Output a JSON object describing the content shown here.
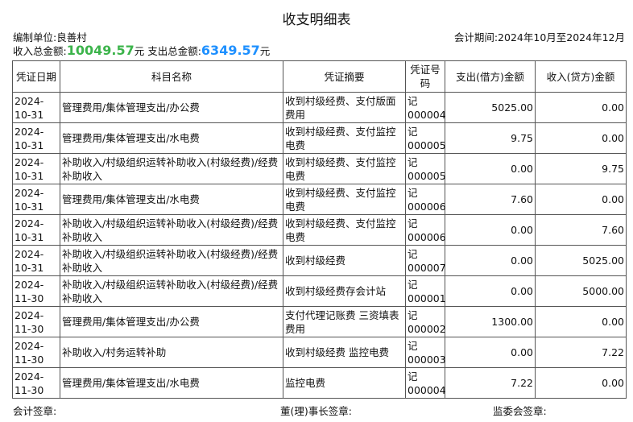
{
  "title": "收支明细表",
  "unit_label": "编制单位:良善村",
  "period_label": "会计期间:2024年10月至2024年12月",
  "totals": {
    "income_label": "收入总金额:",
    "income_value": "10049.57",
    "income_suffix": "元 支出总金额:",
    "expense_value": "6349.57",
    "expense_suffix": "元"
  },
  "table": {
    "headers": [
      "凭证日期",
      "科目名称",
      "凭证摘要",
      "凭证号码",
      "支出(借方)金额",
      "收入(贷方)金额"
    ],
    "rows": [
      {
        "date": "2024-10-31",
        "account": "管理费用/集体管理支出/办公费",
        "summary": "收到村级经费、支付版面费用",
        "voucher": "记000004",
        "debit": "5025.00",
        "credit": "0.00"
      },
      {
        "date": "2024-10-31",
        "account": "管理费用/集体管理支出/水电费",
        "summary": "收到村级经费、支付监控电费",
        "voucher": "记000005",
        "debit": "9.75",
        "credit": "0.00"
      },
      {
        "date": "2024-10-31",
        "account": "补助收入/村级组织运转补助收入(村级经费)/经费补助收入",
        "summary": "收到村级经费、支付监控电费",
        "voucher": "记000005",
        "debit": "0.00",
        "credit": "9.75"
      },
      {
        "date": "2024-10-31",
        "account": "管理费用/集体管理支出/水电费",
        "summary": "收到村级经费、支付监控电费",
        "voucher": "记000006",
        "debit": "7.60",
        "credit": "0.00"
      },
      {
        "date": "2024-10-31",
        "account": "补助收入/村级组织运转补助收入(村级经费)/经费补助收入",
        "summary": "收到村级经费、支付监控电费",
        "voucher": "记000006",
        "debit": "0.00",
        "credit": "7.60"
      },
      {
        "date": "2024-10-31",
        "account": "补助收入/村级组织运转补助收入(村级经费)/经费补助收入",
        "summary": "收到村级经费",
        "voucher": "记000007",
        "debit": "0.00",
        "credit": "5025.00"
      },
      {
        "date": "2024-11-30",
        "account": "补助收入/村级组织运转补助收入(村级经费)/经费补助收入",
        "summary": "收到村级经费存会计站",
        "voucher": "记000001",
        "debit": "0.00",
        "credit": "5000.00"
      },
      {
        "date": "2024-11-30",
        "account": "管理费用/集体管理支出/办公费",
        "summary": "支付代理记账费 三资填表费用",
        "voucher": "记000002",
        "debit": "1300.00",
        "credit": "0.00"
      },
      {
        "date": "2024-11-30",
        "account": "补助收入/村务运转补助",
        "summary": "收到村级经费 监控电费",
        "voucher": "记000003",
        "debit": "0.00",
        "credit": "7.22"
      },
      {
        "date": "2024-11-30",
        "account": "管理费用/集体管理支出/水电费",
        "summary": "监控电费",
        "voucher": "记000004",
        "debit": "7.22",
        "credit": "0.00"
      }
    ]
  },
  "footer": {
    "accountant": "会计签章:",
    "director": "董(理)事长签章:",
    "supervisor": "监委会签章:"
  }
}
